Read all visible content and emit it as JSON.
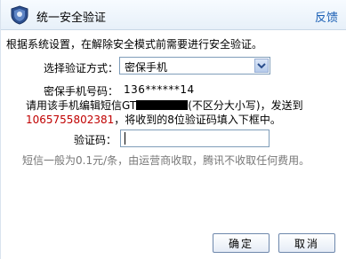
{
  "window": {
    "title": "统一安全验证",
    "feedback_link": "反馈",
    "icon": "shield-icon"
  },
  "form": {
    "intro": "根据系统设置，在解除安全模式前需要进行安全验证。",
    "method_label": "选择验证方式：",
    "method_selected": "密保手机",
    "phone_label": "密保手机号码：",
    "phone_value": "136******14",
    "instruction_line1_pre": "请用该手机编辑短信",
    "instruction_code_prefix": "GT",
    "instruction_line1_post": "(不区分大小写)，发送到",
    "instruction_number": "1065755802381",
    "instruction_line2_post": "，将收到的8位验证码填入下框中。",
    "code_label": "验证码：",
    "code_value": "",
    "note": "短信一般为0.1元/条，由运营商收取，腾讯不收取任何费用。"
  },
  "buttons": {
    "confirm": "确定",
    "cancel": "取消"
  },
  "colors": {
    "link": "#1a5fb4",
    "number_highlight": "#c00000",
    "note_text": "#777777"
  }
}
